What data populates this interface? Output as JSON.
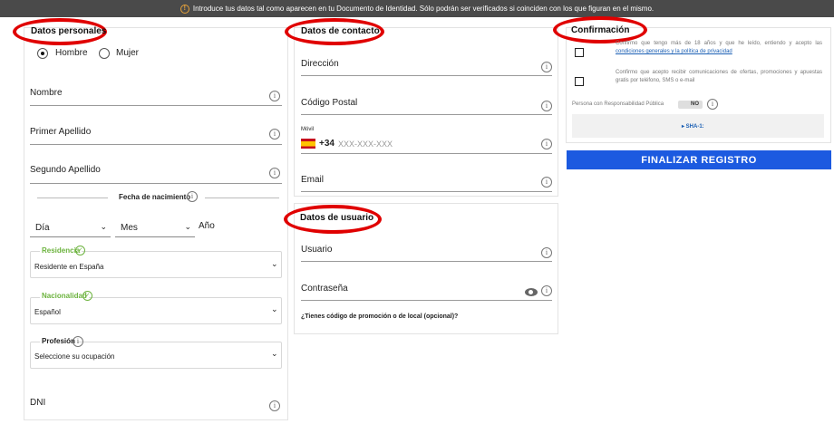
{
  "banner": {
    "text": "Introduce tus datos tal como aparecen en tu Documento de Identidad. Sólo podrán ser verificados si coinciden con los que figuran en el mismo."
  },
  "personal": {
    "title": "Datos personales",
    "gender_male": "Hombre",
    "gender_female": "Mujer",
    "selected_gender": "Hombre",
    "name": "Nombre",
    "surname1": "Primer Apellido",
    "surname2": "Segundo Apellido",
    "birth_label": "Fecha de nacimiento",
    "day": "Día",
    "month": "Mes",
    "year": "Año",
    "residence_label": "Residencia",
    "residence_value": "Residente en España",
    "nationality_label": "Nacionalidad",
    "nationality_value": "Español",
    "profession_label": "Profesión",
    "profession_value": "Seleccione su ocupación",
    "dni": "DNI"
  },
  "contact": {
    "title": "Datos de contacto",
    "address": "Dirección",
    "postal_code": "Código Postal",
    "mobile_label": "Móvil",
    "prefix": "+34",
    "mobile_placeholder": "XXX-XXX-XXX",
    "email": "Email"
  },
  "user": {
    "title": "Datos de usuario",
    "username": "Usuario",
    "password": "Contraseña",
    "promo": "¿Tienes código de promoción o de local (opcional)?"
  },
  "confirm": {
    "title": "Confirmación",
    "age_text_pre": "Confirmo que tengo más de 18 años y que he leído, entiendo y acepto las",
    "age_link": "condiciones generales y la política de privacidad",
    "comms_text": "Confirmo que acepto recibir comunicaciones de ofertas, promociones y apuestas gratis por teléfono, SMS o e-mail",
    "pep_label": "Persona con Responsabilidad Pública",
    "pep_toggle": "NO",
    "sha_label": "▸ SHA-1:",
    "submit": "FINALIZAR REGISTRO"
  },
  "colors": {
    "accent_blue": "#1c5ae0",
    "highlight_red": "#e00000",
    "ok_green": "#6cb33e",
    "banner_bg": "#4a4a4a"
  }
}
